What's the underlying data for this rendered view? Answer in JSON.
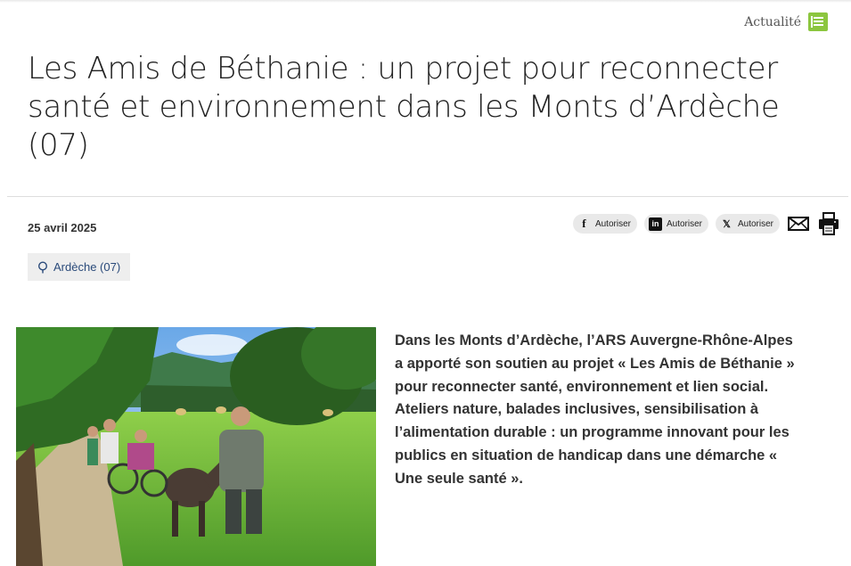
{
  "header": {
    "category": "Actualité",
    "category_icon": "list-icon"
  },
  "article": {
    "title": "Les Amis de Béthanie : un projet pour reconnecter santé et environnement dans les Monts d’Ardèche (07)",
    "date": "25 avril 2025",
    "location_tag": "Ardèche (07)",
    "lead": "Dans les Monts d’Ardèche, l’ARS Auvergne-Rhône-Alpes a apporté son soutien au projet « Les Amis de Béthanie » pour reconnecter santé, environnement et lien social. Ateliers nature, balades inclusives, sensibilisation à l’alimentation durable : un programme innovant pour les publics en situation de handicap dans une démarche « Une seule santé »."
  },
  "share": {
    "facebook_label": "Autoriser",
    "linkedin_label": "Autoriser",
    "x_label": "Autoriser",
    "icons": [
      "facebook-icon",
      "linkedin-icon",
      "x-icon",
      "mail-icon",
      "print-icon"
    ]
  },
  "colors": {
    "accent_green": "#8cc63f",
    "tag_text": "#2a4a7a",
    "tag_bg": "#eeeeee"
  }
}
